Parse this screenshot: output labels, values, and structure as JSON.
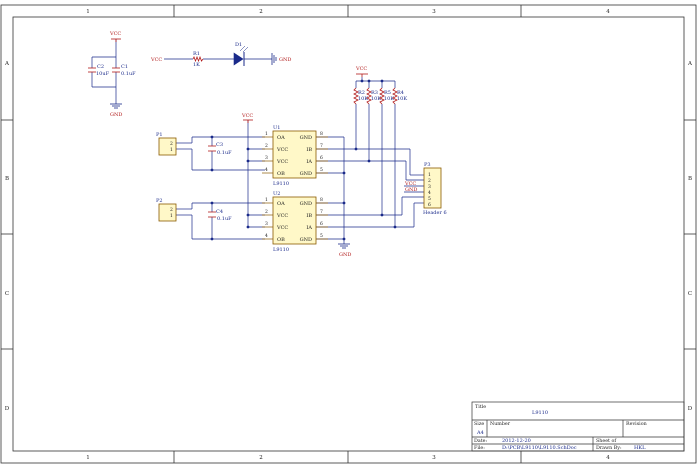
{
  "border": {
    "col_labels": [
      "1",
      "2",
      "3",
      "4"
    ],
    "row_labels": [
      "A",
      "B",
      "C",
      "D"
    ]
  },
  "power": {
    "vcc": "VCC",
    "gnd": "GND"
  },
  "caps_top": {
    "c2_ref": "C2",
    "c2_val": "10uF",
    "c1_ref": "C1",
    "c1_val": "0.1uF"
  },
  "led_row": {
    "r1_ref": "R1",
    "r1_val": "1K",
    "d1_ref": "D1"
  },
  "pullups": {
    "r2": "R2",
    "r3": "R3",
    "r5": "R5",
    "r4": "R4",
    "val": "10K"
  },
  "connectors": {
    "p1_ref": "P1",
    "p2_ref": "P2",
    "pin_2": "2",
    "pin_1": "1",
    "p3_ref": "P3",
    "p3_pins": [
      "1",
      "2",
      "3",
      "4",
      "5",
      "6"
    ],
    "p3_vcc": "VCC",
    "p3_gnd": "GND",
    "p3_name": "Header 6"
  },
  "caps_side": {
    "c3_ref": "C3",
    "c3_val": "0.1uF",
    "c4_ref": "C4",
    "c4_val": "0.1uF"
  },
  "ics": {
    "u1_ref": "U1",
    "u2_ref": "U2",
    "part": "L9110",
    "left_pins": [
      "OA",
      "VCC",
      "VCC",
      "OB"
    ],
    "right_pins": [
      "GND",
      "IB",
      "IA",
      "GND"
    ],
    "left_nums": [
      "1",
      "2",
      "3",
      "4"
    ],
    "right_nums": [
      "8",
      "7",
      "6",
      "5"
    ]
  },
  "title_block": {
    "title_label": "Title",
    "title_value": "L9110",
    "size_label": "Size",
    "size_value": "A4",
    "number_label": "Number",
    "revision_label": "Revision",
    "date_label": "Date:",
    "date_value": "2012-12-20",
    "sheet_label": "Sheet   of",
    "file_label": "File:",
    "file_value": "D:\\PCB\\L9110\\L9110.SchDoc",
    "drawn_label": "Drawn By:",
    "drawn_value": "HKL"
  }
}
